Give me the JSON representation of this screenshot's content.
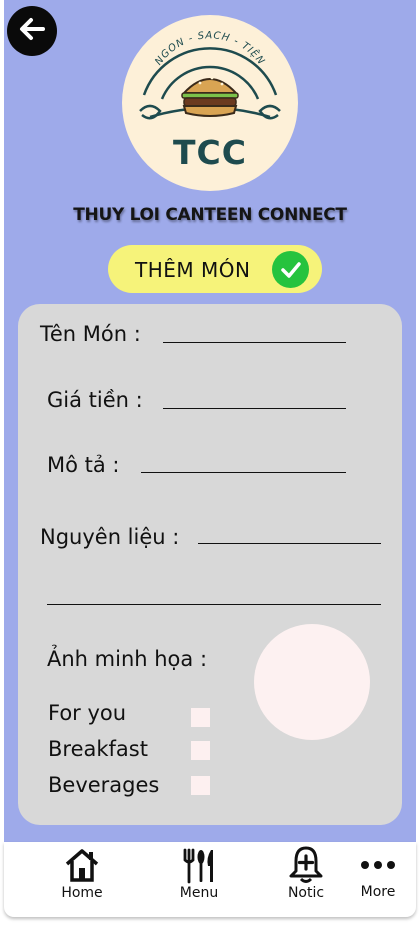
{
  "header": {
    "logo": {
      "banner_text": "NGON - SACH - TIỆN",
      "brand_text": "TCC"
    },
    "app_title": "THUY LOI CANTEEN CONNECT"
  },
  "action": {
    "label": "THÊM MÓN",
    "icon": "check-icon",
    "color": "#f6f37a"
  },
  "form": {
    "name_label": "Tên Món :",
    "price_label": "Giá tiền :",
    "description_label": "Mô tả :",
    "ingredients_label": "Nguyên liệu :",
    "image_label": "Ảnh minh họa :",
    "categories": [
      {
        "label": "For you",
        "checked": false
      },
      {
        "label": "Breakfast",
        "checked": false
      },
      {
        "label": "Beverages",
        "checked": false
      }
    ]
  },
  "nav": {
    "items": [
      {
        "label": "Home",
        "icon": "home-icon"
      },
      {
        "label": "Menu",
        "icon": "utensils-icon"
      },
      {
        "label": "Notic",
        "icon": "bell-plus-icon"
      },
      {
        "label": "More",
        "icon": "more-dots-icon"
      }
    ]
  },
  "colors": {
    "background": "#9eaaea",
    "card": "#d8d8d8",
    "success": "#26c33e"
  }
}
